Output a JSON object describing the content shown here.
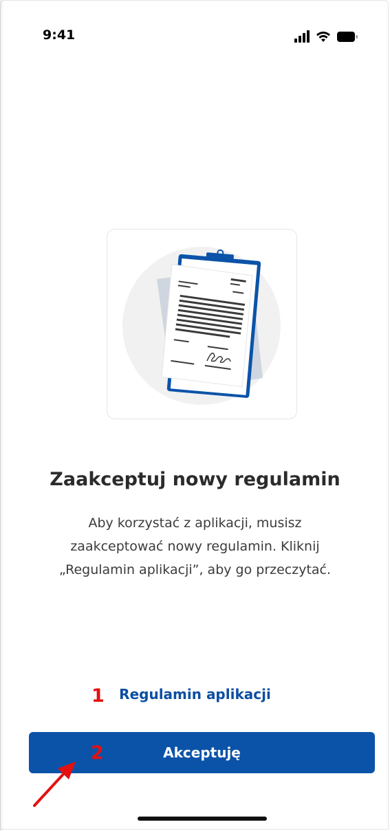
{
  "status_bar": {
    "time": "9:41",
    "icons": [
      "signal-icon",
      "wifi-icon",
      "battery-icon"
    ]
  },
  "illustration": {
    "icon": "document-clipboard-illustration"
  },
  "main": {
    "title": "Zaakceptuj nowy regulamin",
    "description_lines": [
      "Aby korzystać z aplikacji, musisz",
      "zaakceptować nowy regulamin. Kliknij",
      "„Regulamin aplikacji”, aby go przeczytać."
    ]
  },
  "actions": {
    "terms_link_label": "Regulamin aplikacji",
    "accept_label": "Akceptuję"
  },
  "annotations": {
    "marker_1": "1",
    "marker_2": "2"
  },
  "colors": {
    "accent": "#0b53a8",
    "link": "#0b4ea2",
    "annotation": "#e41010"
  }
}
